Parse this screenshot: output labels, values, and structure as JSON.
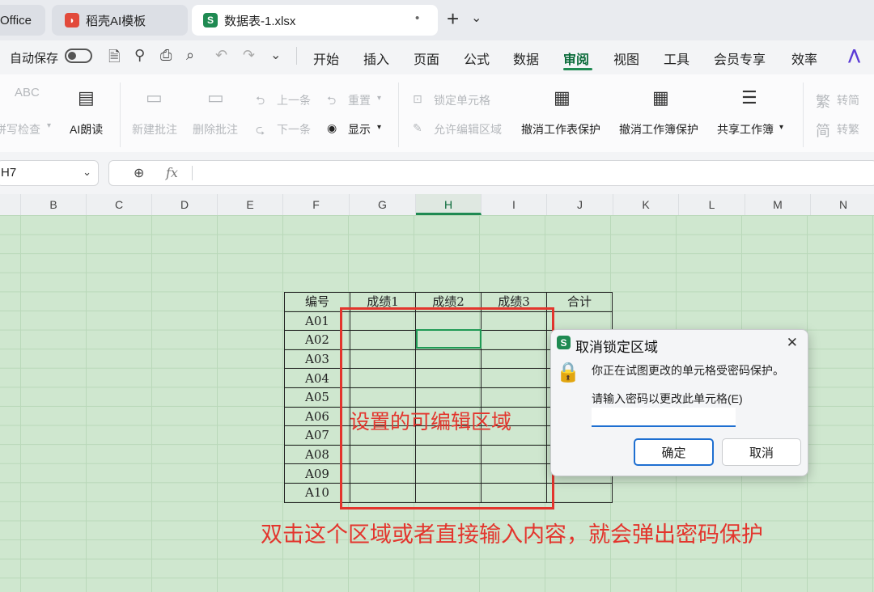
{
  "tabs": [
    {
      "label": "Office"
    },
    {
      "label": "稻壳AI模板"
    },
    {
      "label": "数据表-1.xlsx"
    }
  ],
  "tab_dot": "•",
  "new_tab": "+",
  "tab_menu": "⌄",
  "autosave_label": "自动保存",
  "menu": [
    "开始",
    "插入",
    "页面",
    "公式",
    "数据",
    "审阅",
    "视图",
    "工具",
    "会员专享",
    "效率"
  ],
  "menu_active": "审阅",
  "ribbon": {
    "spell_check": "拼写检查",
    "abc": "ABC",
    "ai_read": "AI朗读",
    "new_comment": "新建批注",
    "delete_comment": "删除批注",
    "prev": "上一条",
    "next": "下一条",
    "reset": "重置",
    "show": "显示",
    "lock_cell": "锁定单元格",
    "allow_edit": "允许编辑区域",
    "unprotect_sheet": "撤消工作表保护",
    "unprotect_book": "撤消工作簿保护",
    "share_book": "共享工作簿",
    "to_simplified": "转简",
    "to_traditional": "转繁",
    "fan": "繁",
    "jian": "简"
  },
  "namebox": "H7",
  "fx": "fx",
  "columns": [
    "B",
    "C",
    "D",
    "E",
    "F",
    "G",
    "H",
    "I",
    "J",
    "K",
    "L",
    "M",
    "N"
  ],
  "selected_column": "H",
  "table": {
    "headers": [
      "编号",
      "成绩1",
      "成绩2",
      "成绩3",
      "合计"
    ],
    "ids": [
      "A01",
      "A02",
      "A03",
      "A04",
      "A05",
      "A06",
      "A07",
      "A08",
      "A09",
      "A10"
    ]
  },
  "annotations": {
    "editable_area": "设置的可编辑区域",
    "note": "双击这个区域或者直接输入内容，就会弹出密码保护"
  },
  "dialog": {
    "icon": "S",
    "title": "取消锁定区域",
    "message": "你正在试图更改的单元格受密码保护。",
    "prompt": "请输入密码以更改此单元格(E)",
    "password_value": "",
    "ok": "确定",
    "cancel": "取消",
    "close": "✕"
  },
  "colors": {
    "accent": "#1f8a52",
    "annotation": "#e3352d",
    "sheet_bg": "#cfe7cf"
  }
}
